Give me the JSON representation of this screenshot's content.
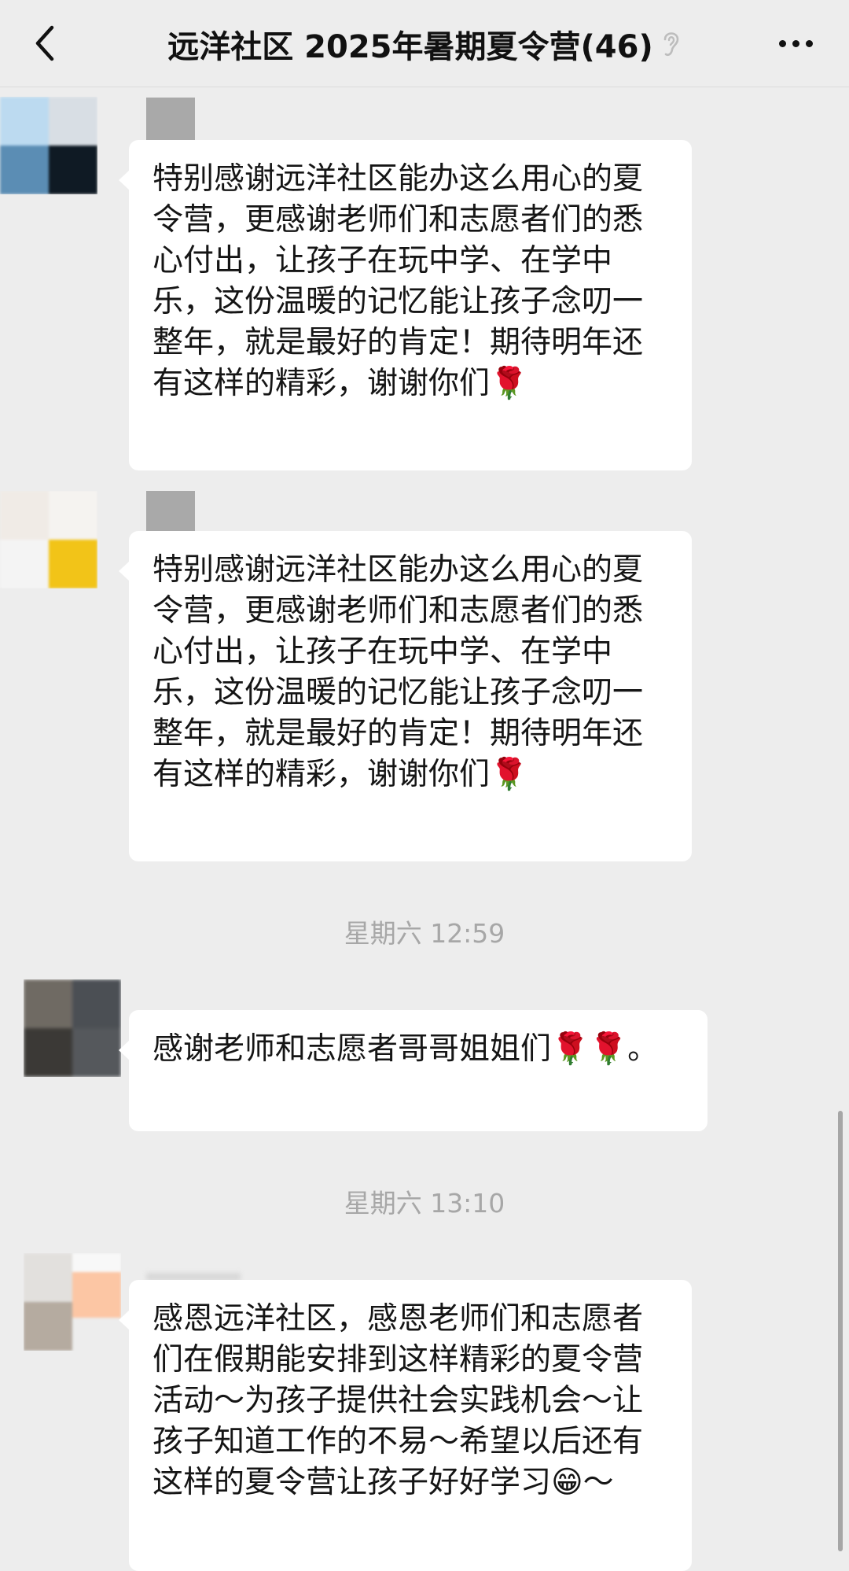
{
  "header": {
    "title": "远洋社区 2025年暑期夏令营(46)",
    "back_icon": "chevron-left-icon",
    "mute_icon": "ear-icon",
    "more_icon": "more-icon"
  },
  "messages": [
    {
      "avatar_colors": [
        "#bcdaf0",
        "#d8dee4",
        "#5b8db4",
        "#0f1a24"
      ],
      "text": "特别感谢远洋社区能办这么用心的夏令营，更感谢老师们和志愿者们的悉心付出，让孩子在玩中学、在学中乐，这份温暖的记忆能让孩子念叨一整年，就是最好的肯定！期待明年还有这样的精彩，谢谢你们🌹"
    },
    {
      "avatar_colors": [
        "#f0ebe6",
        "#f5f3f0",
        "#f2c418",
        "#f4f4f4"
      ],
      "text": "特别感谢远洋社区能办这么用心的夏令营，更感谢老师们和志愿者们的悉心付出，让孩子在玩中学、在学中乐，这份温暖的记忆能让孩子念叨一整年，就是最好的肯定！期待明年还有这样的精彩，谢谢你们🌹"
    },
    {
      "avatar_colors": [
        "#6f6a63",
        "#4b4f54",
        "#3b3936",
        "#55585c"
      ],
      "text": "感谢老师和志愿者哥哥姐姐们🌹🌹。"
    },
    {
      "avatar_colors": [
        "#e2e0dd",
        "#f8f8f8",
        "#b5aba0",
        "#fcc6a4"
      ],
      "text": "感恩远洋社区，感恩老师们和志愿者们在假期能安排到这样精彩的夏令营活动～为孩子提供社会实践机会～让孩子知道工作的不易～希望以后还有这样的夏令营让孩子好好学习😁～"
    }
  ],
  "timestamps": [
    "星期六 12:59",
    "星期六 13:10"
  ]
}
